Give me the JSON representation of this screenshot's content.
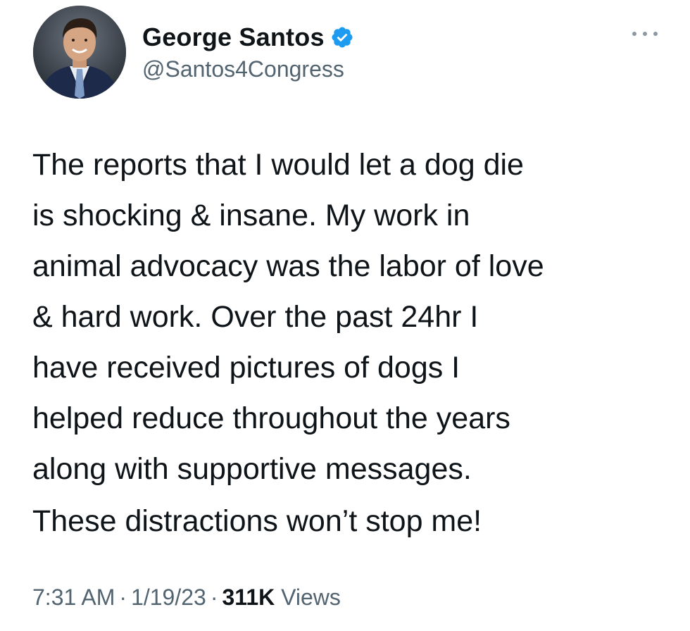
{
  "author": {
    "display_name": "George Santos",
    "handle": "@Santos4Congress",
    "verified": true,
    "verified_color": "#1d9bf0"
  },
  "tweet": {
    "lines": [
      "The reports that I would let a dog die",
      "is shocking & insane. My work in",
      "animal advocacy was the labor of love",
      "& hard work. Over the past 24hr I",
      "have received pictures of dogs I",
      "helped reduce throughout the years",
      "along with supportive messages."
    ],
    "closing": "These distractions won’t stop me!"
  },
  "meta": {
    "time": "7:31 AM",
    "separator": "·",
    "date": "1/19/23",
    "views_count": "311K",
    "views_label": "Views"
  },
  "icons": {
    "more": "more-options-icon",
    "verified": "verified-badge-icon",
    "avatar": "profile-avatar"
  }
}
